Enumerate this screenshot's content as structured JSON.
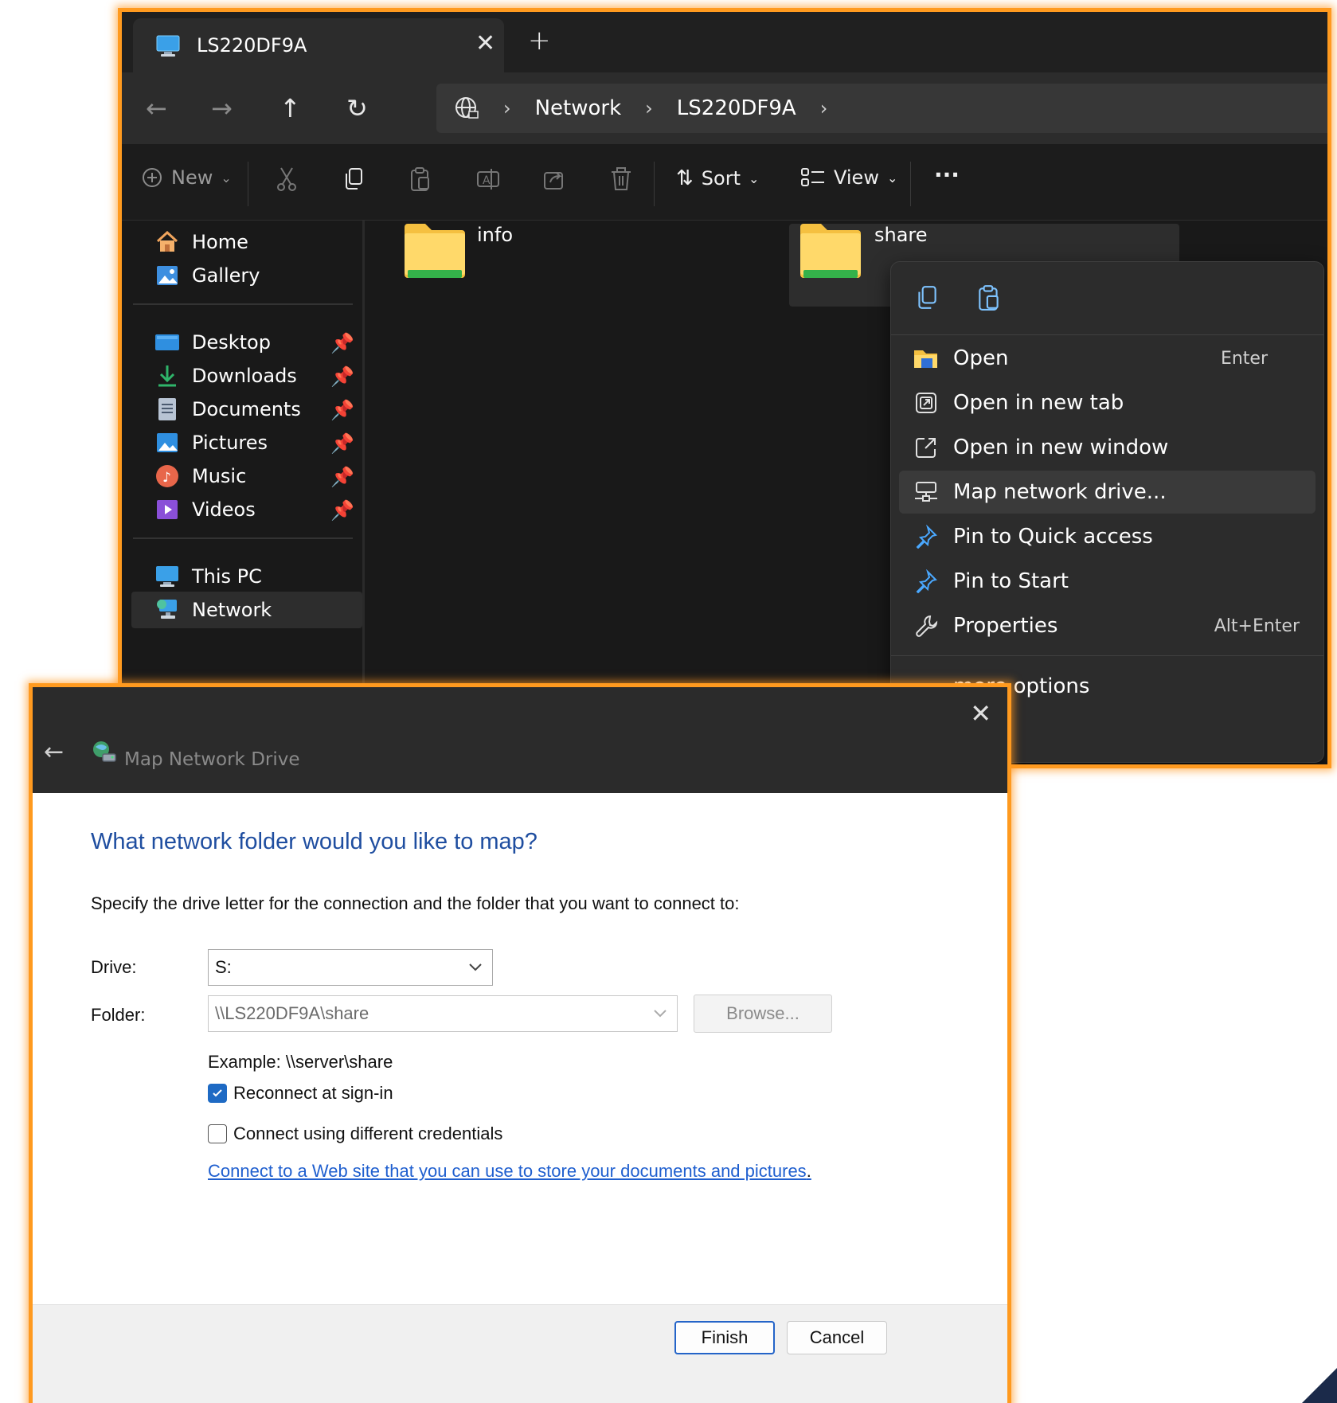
{
  "explorer": {
    "tab_title": "LS220DF9A",
    "breadcrumb": [
      "Network",
      "LS220DF9A"
    ],
    "toolbar": {
      "new_label": "New",
      "sort_label": "Sort",
      "view_label": "View",
      "more_label": "···"
    },
    "sidebar": {
      "top": [
        {
          "label": "Home",
          "icon": "home-icon"
        },
        {
          "label": "Gallery",
          "icon": "gallery-icon"
        }
      ],
      "pinned": [
        {
          "label": "Desktop",
          "icon": "desktop-icon"
        },
        {
          "label": "Downloads",
          "icon": "download-icon"
        },
        {
          "label": "Documents",
          "icon": "document-icon"
        },
        {
          "label": "Pictures",
          "icon": "pictures-icon"
        },
        {
          "label": "Music",
          "icon": "music-icon"
        },
        {
          "label": "Videos",
          "icon": "videos-icon"
        }
      ],
      "bottom": [
        {
          "label": "This PC",
          "icon": "pc-icon"
        },
        {
          "label": "Network",
          "icon": "network-icon",
          "selected": true
        }
      ]
    },
    "folders": [
      {
        "label": "info"
      },
      {
        "label": "share"
      }
    ],
    "context_menu": {
      "items": [
        {
          "label": "Open",
          "shortcut": "Enter",
          "icon": "open-folder-icon"
        },
        {
          "label": "Open in new tab",
          "shortcut": "",
          "icon": "new-tab-icon"
        },
        {
          "label": "Open in new window",
          "shortcut": "",
          "icon": "new-window-icon"
        },
        {
          "label": "Map network drive...",
          "shortcut": "",
          "icon": "map-drive-icon",
          "highlighted": true
        },
        {
          "label": "Pin to Quick access",
          "shortcut": "",
          "icon": "pin-icon"
        },
        {
          "label": "Pin to Start",
          "shortcut": "",
          "icon": "pin-icon"
        },
        {
          "label": "Properties",
          "shortcut": "Alt+Enter",
          "icon": "wrench-icon"
        }
      ],
      "more_label": "more options"
    }
  },
  "dialog": {
    "title": "Map Network Drive",
    "heading": "What network folder would you like to map?",
    "instruction": "Specify the drive letter for the connection and the folder that you want to connect to:",
    "drive_label": "Drive:",
    "drive_value": "S:",
    "folder_label": "Folder:",
    "folder_value": "\\\\LS220DF9A\\share",
    "browse_label": "Browse...",
    "example": "Example: \\\\server\\share",
    "reconnect_label": "Reconnect at sign-in",
    "reconnect_checked": true,
    "credentials_label": "Connect using different credentials",
    "credentials_checked": false,
    "web_link": "Connect to a Web site that you can use to store your documents and pictures",
    "web_link_suffix": ".",
    "finish_label": "Finish",
    "cancel_label": "Cancel"
  },
  "colors": {
    "accent_border": "#ff9a1f",
    "link": "#1f5fcf",
    "heading": "#1f4ea0",
    "checkbox": "#1e6ac4"
  }
}
